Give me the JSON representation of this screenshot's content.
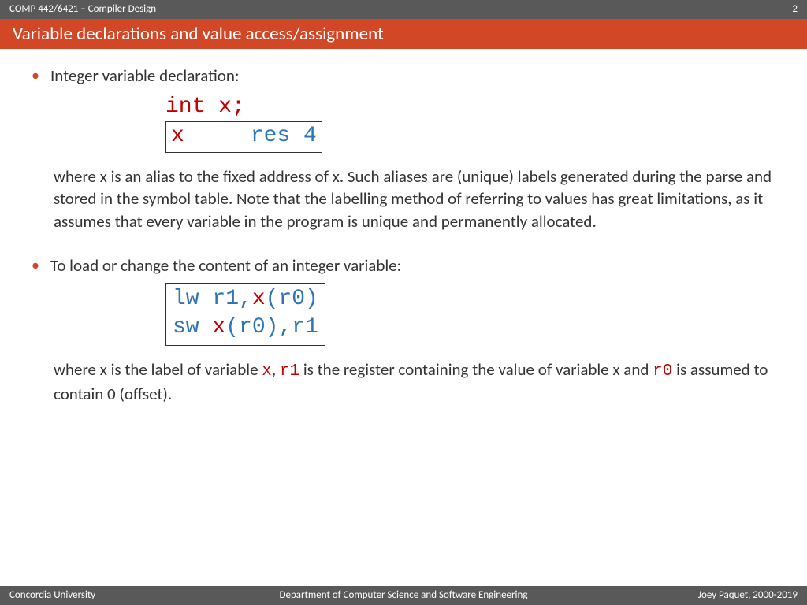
{
  "header": {
    "course": "COMP 442/6421 – Compiler Design",
    "page": "2"
  },
  "title": "Variable declarations and value access/assignment",
  "bullet1": "Integer variable declaration:",
  "code1": {
    "line1": "int x;",
    "line2_label": "x",
    "line2_spacer": "     ",
    "line2_rest": "res 4"
  },
  "para1_a": "where x is an alias to the fixed address of x. Such aliases are (unique) labels generated during the parse and stored in the symbol table. Note that the labelling method of referring to values has great limitations, as it assumes that every variable in the program is unique and permanently allocated.",
  "bullet2": "To load or change the content of an integer variable:",
  "code2": {
    "lw": "lw r1,",
    "x1": "x",
    "r0a": "(r0)",
    "sw": "sw ",
    "x2": "x",
    "r0b": "(r0)",
    "r1": ",r1"
  },
  "para2": {
    "t1": "where x is the label of variable ",
    "x": "x",
    "t2": ", ",
    "r1": "r1",
    "t3": " is the register containing the value of variable x and ",
    "r0": "r0",
    "t4": " is assumed to contain 0 (offset)."
  },
  "footer": {
    "left": "Concordia University",
    "center": "Department of Computer Science and Software Engineering",
    "right": "Joey Paquet, 2000-2019"
  }
}
